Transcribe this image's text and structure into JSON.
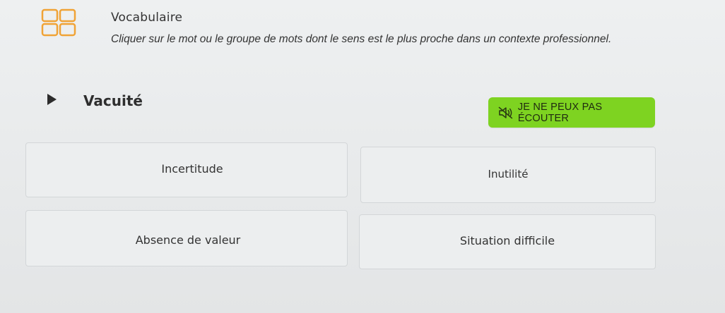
{
  "header": {
    "title": "Vocabulaire",
    "instruction": "Cliquer sur le mot ou le groupe de mots dont le sens est le plus proche dans un contexte professionnel.",
    "icon": "grid-icon"
  },
  "question": {
    "word": "Vacuité",
    "play_icon": "play-icon"
  },
  "listen_button": {
    "label": "JE NE PEUX PAS ÉCOUTER",
    "icon": "speaker-muted-icon",
    "color": "#7ed321"
  },
  "options": [
    {
      "label": "Incertitude"
    },
    {
      "label": "Inutilité"
    },
    {
      "label": "Absence de valeur"
    },
    {
      "label": "Situation difficile"
    }
  ],
  "colors": {
    "accent": "#7ed321",
    "text": "#333333"
  }
}
